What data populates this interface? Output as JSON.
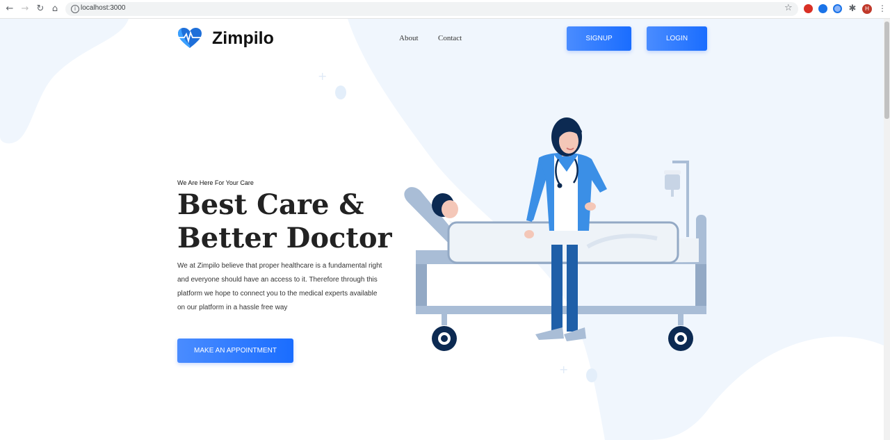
{
  "browser": {
    "url": "localhost:3000",
    "avatar_letter": "H"
  },
  "header": {
    "brand": "Zimpilo",
    "nav": {
      "about": "About",
      "contact": "Contact"
    },
    "signup_label": "SIGNUP",
    "login_label": "LOGIN"
  },
  "hero": {
    "tagline": "We Are Here For Your Care",
    "headline_line1": "Best Care &",
    "headline_line2": "Better Doctor",
    "description": "We at Zimpilo believe that proper healthcare is a fundamental right and everyone should have an access to it. Therefore through this platform we hope to connect you to the medical experts available on our platform in a hassle free way",
    "cta_label": "MAKE AN APPOINTMENT"
  },
  "colors": {
    "accent": "#1a6dff",
    "accent_light": "#4a8cff",
    "background_blob": "#f0f6fd",
    "navy": "#0c2a52"
  },
  "icons": {
    "back": "arrow-left-icon",
    "forward": "arrow-right-icon",
    "reload": "reload-icon",
    "home": "home-icon",
    "info": "info-icon",
    "bookmark": "star-icon",
    "extensions": "puzzle-icon",
    "menu": "kebab-menu-icon",
    "logo": "heart-pulse-icon"
  }
}
